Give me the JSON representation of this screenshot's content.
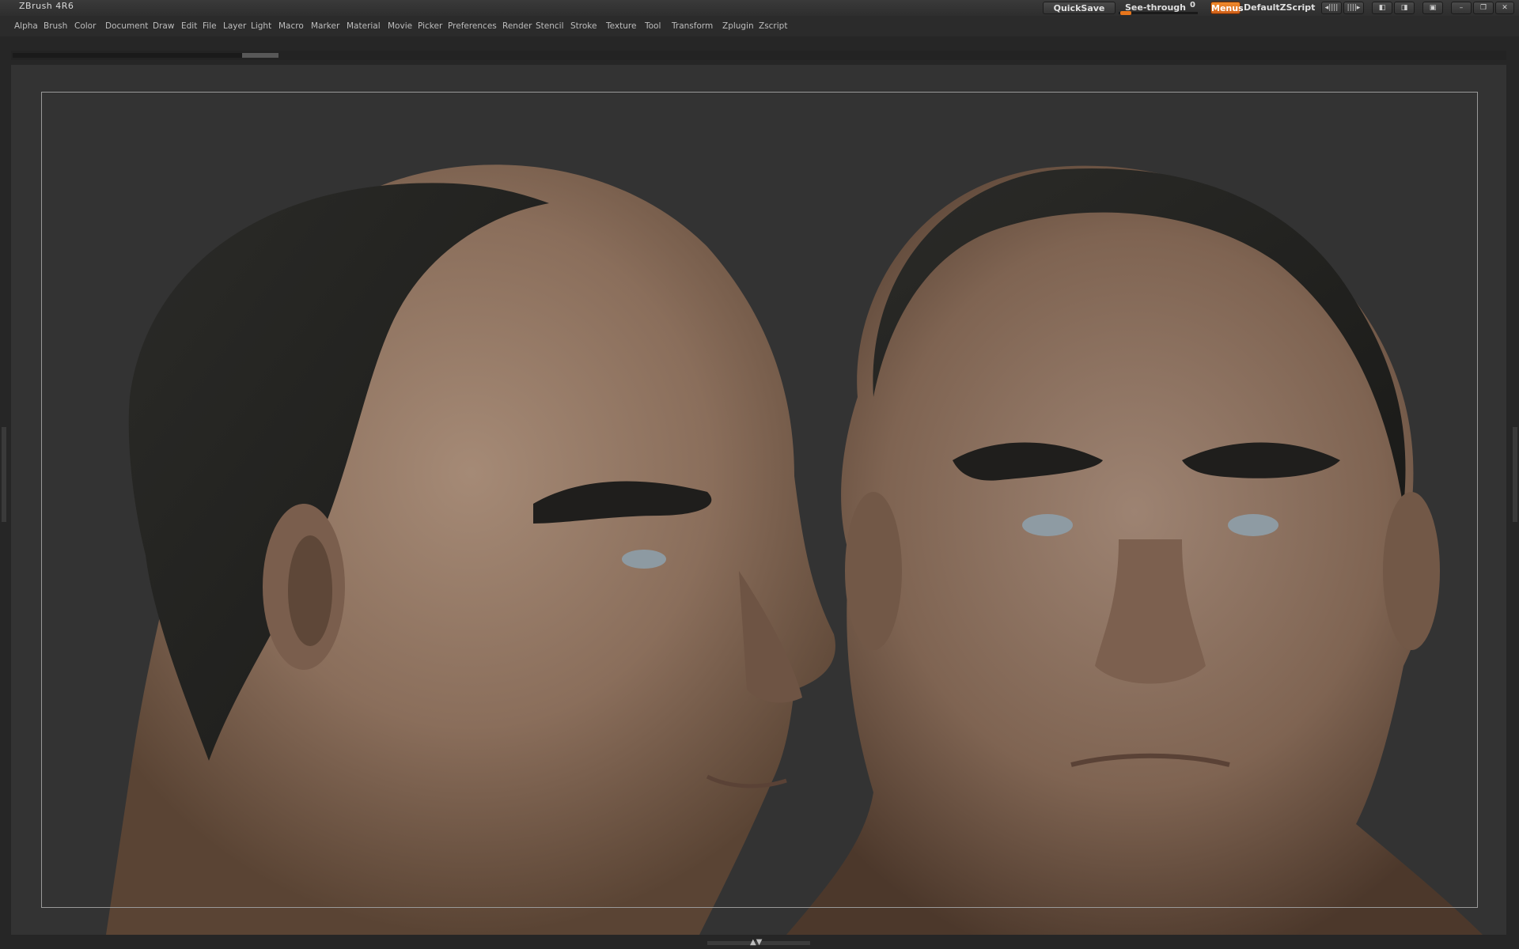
{
  "app": {
    "title": "ZBrush 4R6"
  },
  "top_controls": {
    "quicksave": "QuickSave",
    "see_through_label": "See-through",
    "see_through_value": "0",
    "see_through_fraction": 0.0,
    "menus": "Menus",
    "script_name": "DefaultZScript"
  },
  "menu": {
    "items": [
      "Alpha",
      "Brush",
      "Color",
      "Document",
      "Draw",
      "Edit",
      "File",
      "Layer",
      "Light",
      "Macro",
      "Marker",
      "Material",
      "Movie",
      "Picker",
      "Preferences",
      "Render",
      "Stencil",
      "Stroke",
      "Texture",
      "Tool",
      "Transform",
      "Zplugin",
      "Zscript"
    ]
  },
  "icons": {
    "window": [
      "minimize-icon",
      "restore-icon",
      "close-icon"
    ],
    "toolbar": [
      "dock-left-icon",
      "dock-right-icon",
      "layout-a-icon",
      "layout-b-icon",
      "lock-icon"
    ]
  },
  "colors": {
    "accent": "#e8761c",
    "canvas": "#333333",
    "frame": "#9a9a9a"
  }
}
